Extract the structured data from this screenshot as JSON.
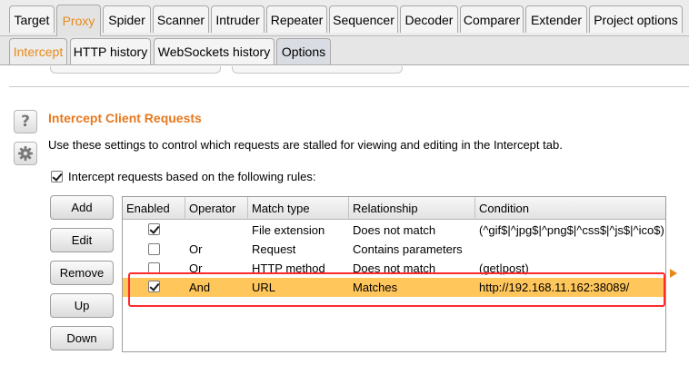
{
  "top_tabs": [
    "Target",
    "Proxy",
    "Spider",
    "Scanner",
    "Intruder",
    "Repeater",
    "Sequencer",
    "Decoder",
    "Comparer",
    "Extender",
    "Project options"
  ],
  "sub_tabs": [
    "Intercept",
    "HTTP history",
    "WebSockets history",
    "Options"
  ],
  "section": {
    "title": "Intercept Client Requests",
    "description": "Use these settings to control which requests are stalled for viewing and editing in the Intercept tab.",
    "rule_checkbox_label": "Intercept requests based on the following rules:",
    "rule_checkbox_checked": true
  },
  "buttons": {
    "add": "Add",
    "edit": "Edit",
    "remove": "Remove",
    "up": "Up",
    "down": "Down"
  },
  "table": {
    "headers": [
      "Enabled",
      "Operator",
      "Match type",
      "Relationship",
      "Condition"
    ],
    "rows": [
      {
        "enabled": true,
        "operator": "",
        "match_type": "File extension",
        "relationship": "Does not match",
        "condition": "(^gif$|^jpg$|^png$|^css$|^js$|^ico$)"
      },
      {
        "enabled": false,
        "operator": "Or",
        "match_type": "Request",
        "relationship": "Contains parameters",
        "condition": ""
      },
      {
        "enabled": false,
        "operator": "Or",
        "match_type": "HTTP method",
        "relationship": "Does not match",
        "condition": "(get|post)"
      },
      {
        "enabled": true,
        "operator": "And",
        "match_type": "URL",
        "relationship": "Matches",
        "condition": "http://192.168.11.162:38089/"
      }
    ],
    "selected_row": 3
  },
  "colors": {
    "accent": "#e88a1a",
    "title": "#e8791f",
    "selection": "#ffc65c",
    "highlight_box": "#ff2a2a"
  },
  "icons": {
    "help": "help-icon",
    "settings": "gear-icon"
  }
}
